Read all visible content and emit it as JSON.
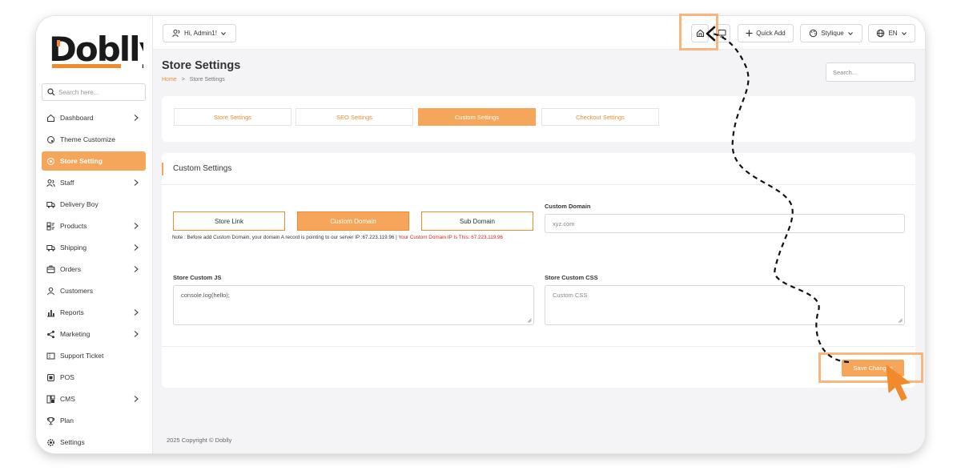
{
  "sidebar": {
    "logo_text": "Doblly",
    "search_placeholder": "Search here...",
    "items": [
      {
        "label": "Dashboard",
        "icon": "home-icon",
        "has_submenu": true,
        "active": false
      },
      {
        "label": "Theme Customize",
        "icon": "palette-icon",
        "has_submenu": false,
        "active": false
      },
      {
        "label": "Store Setting",
        "icon": "settings-icon",
        "has_submenu": false,
        "active": true
      },
      {
        "label": "Staff",
        "icon": "users-icon",
        "has_submenu": true,
        "active": false
      },
      {
        "label": "Delivery Boy",
        "icon": "truck-icon",
        "has_submenu": false,
        "active": false
      },
      {
        "label": "Products",
        "icon": "tag-icon",
        "has_submenu": true,
        "active": false
      },
      {
        "label": "Shipping",
        "icon": "truck-icon",
        "has_submenu": true,
        "active": false
      },
      {
        "label": "Orders",
        "icon": "box-icon",
        "has_submenu": true,
        "active": false
      },
      {
        "label": "Customers",
        "icon": "user-icon",
        "has_submenu": false,
        "active": false
      },
      {
        "label": "Reports",
        "icon": "chart-icon",
        "has_submenu": true,
        "active": false
      },
      {
        "label": "Marketing",
        "icon": "share-icon",
        "has_submenu": true,
        "active": false
      },
      {
        "label": "Support Ticket",
        "icon": "ticket-icon",
        "has_submenu": false,
        "active": false
      },
      {
        "label": "POS",
        "icon": "pos-icon",
        "has_submenu": false,
        "active": false
      },
      {
        "label": "CMS",
        "icon": "cms-icon",
        "has_submenu": true,
        "active": false
      },
      {
        "label": "Plan",
        "icon": "trophy-icon",
        "has_submenu": false,
        "active": false
      },
      {
        "label": "Settings",
        "icon": "gear-icon",
        "has_submenu": false,
        "active": false
      }
    ]
  },
  "topbar": {
    "greeting": "Hi, Admin1!",
    "quick_add": "Quick Add",
    "theme": "Stylique",
    "language": "EN"
  },
  "page": {
    "title": "Store Settings",
    "breadcrumb_home": "Home",
    "breadcrumb_sep": ">",
    "breadcrumb_current": "Store Settings",
    "search_placeholder": "Search..."
  },
  "tabs": [
    {
      "label": "Store Settings",
      "active": false
    },
    {
      "label": "SEO Settings",
      "active": false
    },
    {
      "label": "Custom Settings",
      "active": true
    },
    {
      "label": "Checkout Settings",
      "active": false
    }
  ],
  "custom_settings": {
    "card_title": "Custom Settings",
    "link_options": [
      {
        "label": "Store Link",
        "active": false
      },
      {
        "label": "Custom Domain",
        "active": true
      },
      {
        "label": "Sub Domain",
        "active": false
      }
    ],
    "note_text": "Note : Before add Custom Domain, your domain A record is pointing to our server IP :67.223.119.96 |",
    "note_ip_text": "Your Custom Domain IP Is This: 67.223.119.96",
    "custom_domain_label": "Custom Domain",
    "custom_domain_placeholder": "xyz.com",
    "custom_js_label": "Store Custom JS",
    "custom_js_value": "console.log(hello);",
    "custom_css_label": "Store Custom CSS",
    "custom_css_placeholder": "Custom CSS",
    "save_label": "Save Changes"
  },
  "footer": {
    "copyright": "2025 Copyright © Doblly"
  },
  "colors": {
    "accent": "#f6a65a",
    "accent_text": "#f08a2c",
    "highlight": "#f8b57c",
    "note_red": "#e2231a"
  }
}
